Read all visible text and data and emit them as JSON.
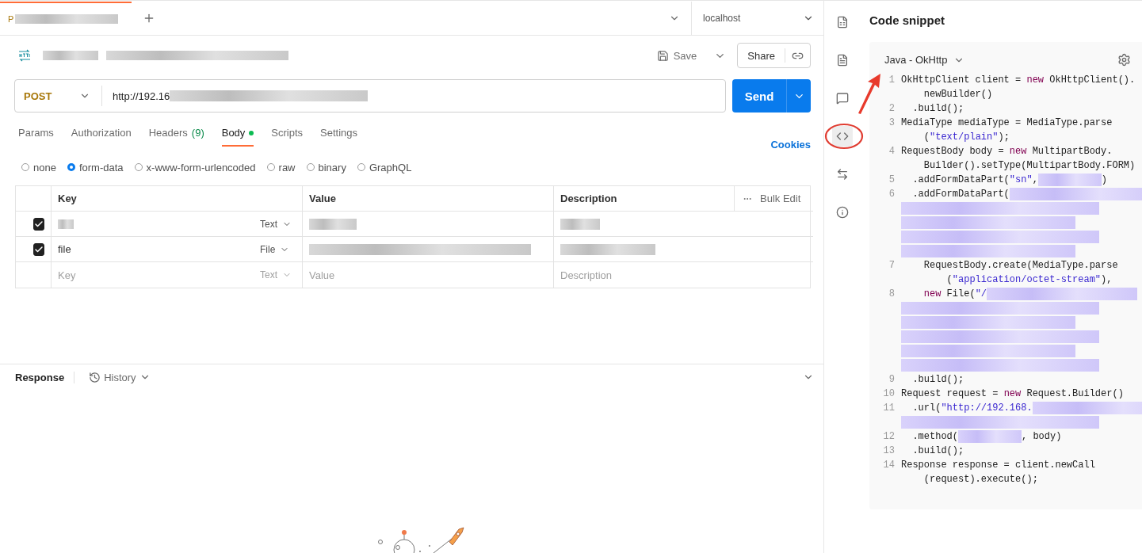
{
  "tab_bar": {
    "tab": {
      "label": "P"
    },
    "environment": "localhost"
  },
  "request": {
    "method": "POST",
    "url": "http://192.16",
    "save": "Save",
    "share": "Share",
    "send": "Send"
  },
  "request_tabs": [
    {
      "label": "Params",
      "selected": false,
      "dot": false
    },
    {
      "label": "Authorization",
      "selected": false,
      "dot": false
    },
    {
      "label": "Headers",
      "count": "(9)",
      "selected": false,
      "dot": false
    },
    {
      "label": "Body",
      "selected": true,
      "dot": true
    },
    {
      "label": "Scripts",
      "selected": false,
      "dot": false
    },
    {
      "label": "Settings",
      "selected": false,
      "dot": false
    }
  ],
  "cookies": "Cookies",
  "body_types": [
    {
      "label": "none",
      "selected": false
    },
    {
      "label": "form-data",
      "selected": true
    },
    {
      "label": "x-www-form-urlencoded",
      "selected": false
    },
    {
      "label": "raw",
      "selected": false
    },
    {
      "label": "binary",
      "selected": false
    },
    {
      "label": "GraphQL",
      "selected": false
    }
  ],
  "table": {
    "columns": [
      "Key",
      "Value",
      "Description"
    ],
    "bulk_edit": "Bulk Edit",
    "rows": [
      {
        "checked": true,
        "type": "Text"
      },
      {
        "checked": true,
        "key": "file",
        "type": "File"
      }
    ],
    "new_row": {
      "key": "Key",
      "type": "Text",
      "value": "Value",
      "description": "Description"
    }
  },
  "response": {
    "title": "Response",
    "history": "History"
  },
  "rail": [
    {
      "kind": "variables",
      "selected": false
    },
    {
      "kind": "docs",
      "selected": false
    },
    {
      "kind": "comments",
      "selected": false
    },
    {
      "kind": "code",
      "selected": true
    },
    {
      "kind": "related",
      "selected": false
    },
    {
      "kind": "info",
      "selected": false
    }
  ],
  "snippet": {
    "title": "Code snippet",
    "language": "Java - OkHttp",
    "lines": [
      {
        "n": "1",
        "rows": [
          [
            {
              "t": "OkHttpClient client = "
            },
            {
              "t": "new",
              "kind": "keyword"
            },
            {
              "t": " OkHttpClient()."
            }
          ],
          [
            {
              "t": "    newBuilder()"
            }
          ]
        ]
      },
      {
        "n": "2",
        "rows": [
          [
            {
              "t": "  .build();"
            }
          ]
        ]
      },
      {
        "n": "3",
        "rows": [
          [
            {
              "t": "MediaType mediaType = MediaType.parse"
            }
          ],
          [
            {
              "t": "    ("
            },
            {
              "t": "\"text/plain\"",
              "kind": "string"
            },
            {
              "t": ");"
            }
          ]
        ]
      },
      {
        "n": "4",
        "rows": [
          [
            {
              "t": "RequestBody body = "
            },
            {
              "t": "new",
              "kind": "keyword"
            },
            {
              "t": " MultipartBody."
            }
          ],
          [
            {
              "t": "    Builder().setType(MultipartBody.FORM)"
            }
          ]
        ]
      },
      {
        "n": "5",
        "rows": [
          [
            {
              "t": "  .addFormDataPart("
            },
            {
              "t": "\"sn\"",
              "kind": "string"
            },
            {
              "t": ","
            },
            {
              "kind": "redacted"
            },
            {
              "t": ")"
            }
          ]
        ]
      },
      {
        "n": "6",
        "rows": [
          [
            {
              "t": "  .addFormDataPart("
            },
            {
              "kind": "redacted"
            }
          ],
          [
            {
              "kind": "redacted"
            }
          ],
          [
            {
              "kind": "redacted"
            }
          ],
          [
            {
              "kind": "redacted"
            }
          ],
          [
            {
              "kind": "redacted"
            }
          ]
        ]
      },
      {
        "n": "7",
        "rows": [
          [
            {
              "t": "    RequestBody.create(MediaType.parse"
            }
          ],
          [
            {
              "t": "        ("
            },
            {
              "t": "\"application/octet-stream\"",
              "kind": "string"
            },
            {
              "t": "),"
            }
          ]
        ]
      },
      {
        "n": "8",
        "rows": [
          [
            {
              "t": "    new",
              "kind": "keyword"
            },
            {
              "t": " File("
            },
            {
              "t": "\"/",
              "kind": "string"
            },
            {
              "kind": "redacted"
            }
          ],
          [
            {
              "kind": "redacted"
            }
          ],
          [
            {
              "kind": "redacted"
            }
          ],
          [
            {
              "kind": "redacted"
            }
          ],
          [
            {
              "kind": "redacted"
            }
          ],
          [
            {
              "kind": "redacted"
            }
          ]
        ]
      },
      {
        "n": "9",
        "rows": [
          [
            {
              "t": "  .build();"
            }
          ]
        ]
      },
      {
        "n": "10",
        "rows": [
          [
            {
              "t": "Request request = "
            },
            {
              "t": "new",
              "kind": "keyword"
            },
            {
              "t": " Request.Builder()"
            }
          ]
        ]
      },
      {
        "n": "11",
        "rows": [
          [
            {
              "t": "  .url("
            },
            {
              "t": "\"http://192.168.",
              "kind": "string"
            },
            {
              "kind": "redacted"
            }
          ],
          [
            {
              "kind": "redacted"
            }
          ]
        ]
      },
      {
        "n": "12",
        "rows": [
          [
            {
              "t": "  .method("
            },
            {
              "kind": "redacted"
            },
            {
              "t": ", body)"
            }
          ]
        ]
      },
      {
        "n": "13",
        "rows": [
          [
            {
              "t": "  .build();"
            }
          ]
        ]
      },
      {
        "n": "14",
        "rows": [
          [
            {
              "t": "Response response = client.newCall"
            }
          ],
          [
            {
              "t": "    (request).execute();"
            }
          ]
        ]
      }
    ]
  }
}
